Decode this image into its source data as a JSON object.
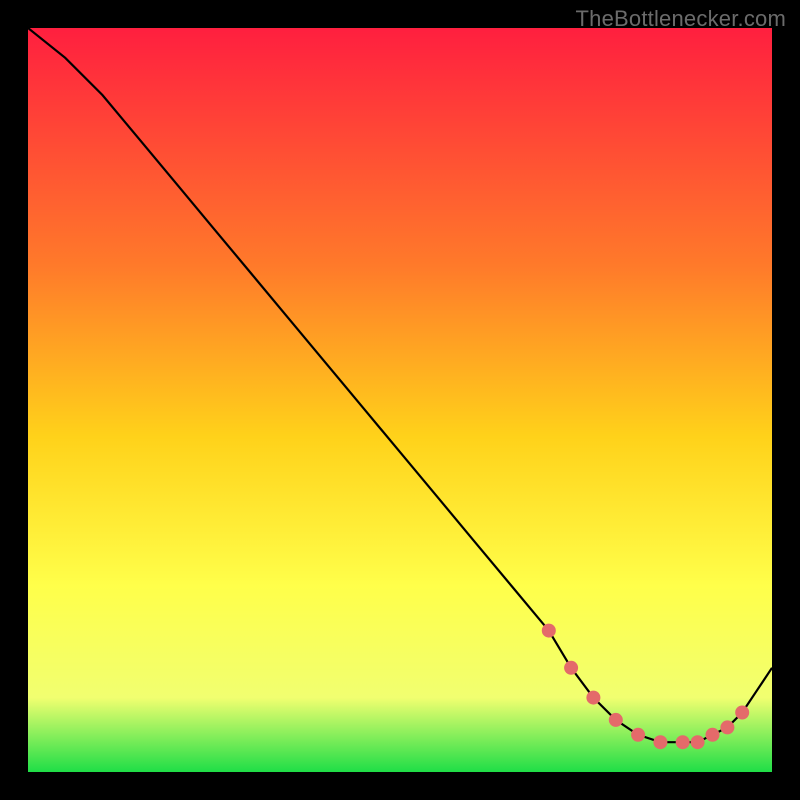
{
  "attribution": "TheBottlenecker.com",
  "colors": {
    "background": "#000000",
    "gradient_top": "#ff1f3f",
    "gradient_mid1": "#ff7a2a",
    "gradient_mid2": "#ffd21a",
    "gradient_mid3": "#ffff4a",
    "gradient_mid4": "#f1ff70",
    "gradient_bottom": "#1fde47",
    "line": "#000000",
    "marker": "#e46a6a"
  },
  "chart_data": {
    "type": "line",
    "title": "",
    "xlabel": "",
    "ylabel": "",
    "xlim": [
      0,
      100
    ],
    "ylim": [
      0,
      100
    ],
    "grid": false,
    "legend": false,
    "x": [
      0,
      5,
      10,
      15,
      20,
      25,
      30,
      35,
      40,
      45,
      50,
      55,
      60,
      65,
      70,
      73,
      76,
      79,
      82,
      85,
      88,
      90,
      92,
      94,
      96,
      98,
      100
    ],
    "values": [
      100,
      96,
      91,
      85,
      79,
      73,
      67,
      61,
      55,
      49,
      43,
      37,
      31,
      25,
      19,
      14,
      10,
      7,
      5,
      4,
      4,
      4,
      5,
      6,
      8,
      11,
      14
    ],
    "markers": {
      "x": [
        70,
        73,
        76,
        79,
        82,
        85,
        88,
        90,
        92,
        94,
        96
      ],
      "y": [
        19,
        14,
        10,
        7,
        5,
        4,
        4,
        4,
        5,
        6,
        8
      ]
    }
  }
}
